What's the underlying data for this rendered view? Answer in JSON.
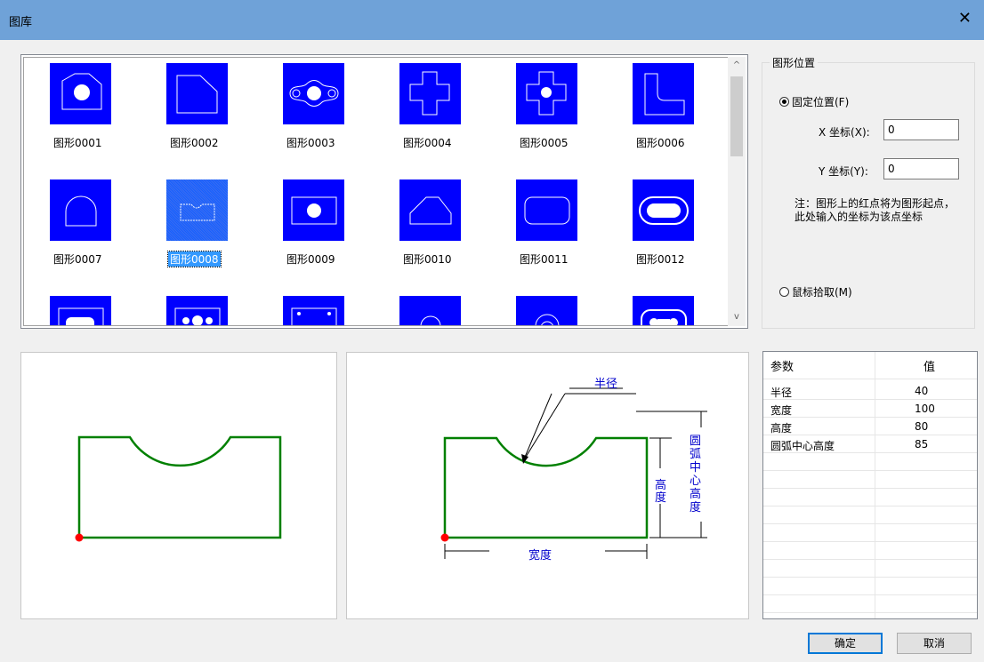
{
  "window": {
    "title": "图库",
    "close_glyph": "✕"
  },
  "gallery": {
    "items": [
      {
        "label": "图形0001"
      },
      {
        "label": "图形0002"
      },
      {
        "label": "图形0003"
      },
      {
        "label": "图形0004"
      },
      {
        "label": "图形0005"
      },
      {
        "label": "图形0006"
      },
      {
        "label": "图形0007"
      },
      {
        "label": "图形0008"
      },
      {
        "label": "图形0009"
      },
      {
        "label": "图形0010"
      },
      {
        "label": "图形0011"
      },
      {
        "label": "图形0012"
      }
    ],
    "selected": "图形0008",
    "scroll_up": "^",
    "scroll_down": "v"
  },
  "position_group": {
    "title": "图形位置",
    "fixed_label": "固定位置(F)",
    "x_label": "X 坐标(X):",
    "x_value": "0",
    "y_label": "Y 坐标(Y):",
    "y_value": "0",
    "note": "注：图形上的红点将为图形起点，此处输入的坐标为该点坐标",
    "mouse_label": "鼠标拾取(M)"
  },
  "diagram": {
    "radius_label": "半径",
    "height_label": "高度",
    "arc_center_height_label": "圆弧中心高度",
    "width_label": "宽度"
  },
  "params": {
    "header_name": "参数",
    "header_value": "值",
    "rows": [
      {
        "name": "半径",
        "value": "40"
      },
      {
        "name": "宽度",
        "value": "100"
      },
      {
        "name": "高度",
        "value": "80"
      },
      {
        "name": "圆弧中心高度",
        "value": "85"
      }
    ]
  },
  "buttons": {
    "ok": "确定",
    "cancel": "取消"
  },
  "colors": {
    "title_bar": "#6fa2d8",
    "thumb_bg": "#0000ff",
    "outline": "#008000",
    "dim": "#0000cc",
    "origin": "#ff0000"
  }
}
